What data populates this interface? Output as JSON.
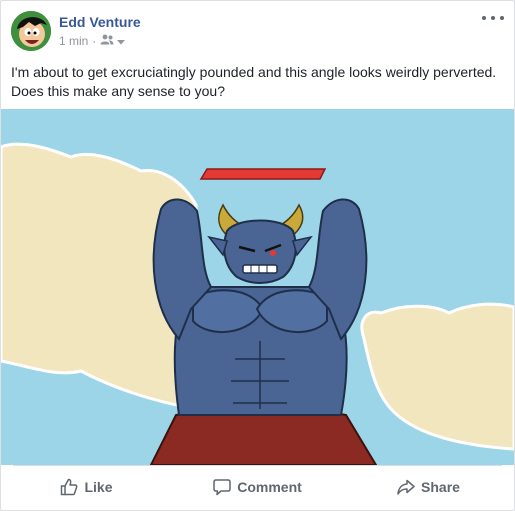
{
  "post": {
    "author": "Edd Venture",
    "timestamp": "1 min",
    "separator": "·",
    "audience_icon": "friends-icon",
    "text": "I'm about to get excruciatingly pounded and this angle looks weirdly perverted. Does this make any sense to you?"
  },
  "actions": {
    "like": "Like",
    "comment": "Comment",
    "share": "Share"
  },
  "colors": {
    "author_link": "#365899",
    "action_text": "#606770",
    "sky": "#9bd5e7",
    "cloud": "#f2e6bf",
    "creature": "#4a6593",
    "health_bar": "#e53935"
  }
}
